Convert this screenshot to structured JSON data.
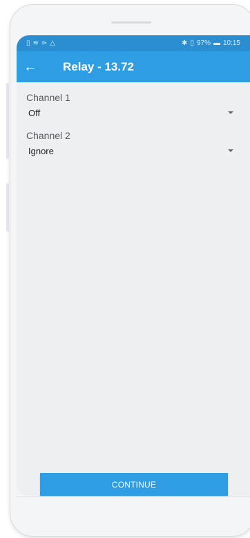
{
  "status": {
    "left_icons": [
      "sim-icon",
      "wifi-icon",
      "cast-icon",
      "warning-icon"
    ],
    "battery_percent": "97%",
    "time": "10:15"
  },
  "appbar": {
    "title": "Relay - 13.72"
  },
  "fields": [
    {
      "label": "Channel 1",
      "value": "Off"
    },
    {
      "label": "Channel 2",
      "value": "Ignore"
    }
  ],
  "actions": {
    "continue_label": "CONTINUE"
  },
  "colors": {
    "accent": "#2e9de4",
    "statusbar": "#2a8ed1",
    "screen_bg": "#eeeff0"
  }
}
